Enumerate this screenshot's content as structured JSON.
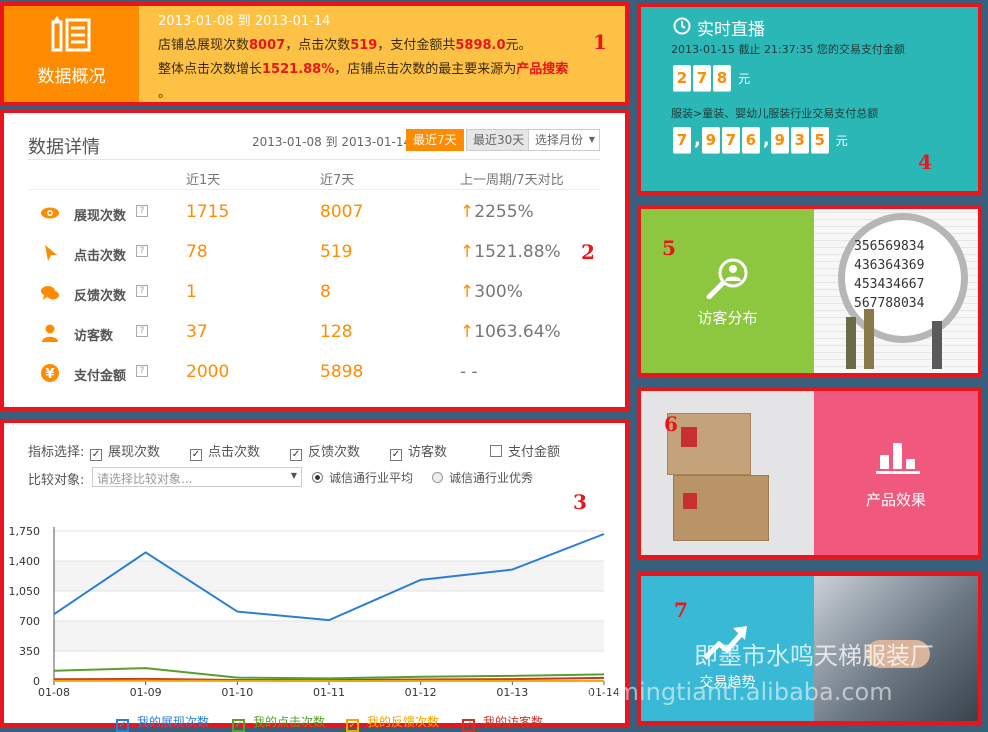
{
  "overview": {
    "title": "数据概况",
    "date_range": "2013-01-08 到 2013-01-14",
    "line1_prefix": "店铺总展现次数",
    "line1_impr": "8007",
    "line1_mid1": "，点击次数",
    "line1_click": "519",
    "line1_mid2": "，支付金额共",
    "line1_pay": "5898.0",
    "line1_suffix": "元。",
    "line2_prefix": "整体点击次数增长",
    "line2_growth": "1521.88%",
    "line2_mid": "，店铺点击次数的最主要来源为",
    "line2_source": "产品搜索",
    "line3": "。"
  },
  "detail": {
    "title": "数据详情",
    "date_range": "2013-01-08 到 2013-01-14",
    "tab_7": "最近7天",
    "tab_30": "最近30天",
    "month_select": "选择月份",
    "headers": [
      "近1天",
      "近7天",
      "上一周期/7天对比"
    ],
    "rows": [
      {
        "label": "展现次数",
        "icon": "eye-icon",
        "d1": "1715",
        "d7": "8007",
        "cmp": "2255%",
        "up": true
      },
      {
        "label": "点击次数",
        "icon": "cursor-icon",
        "d1": "78",
        "d7": "519",
        "cmp": "1521.88%",
        "up": true
      },
      {
        "label": "反馈次数",
        "icon": "chat-icon",
        "d1": "1",
        "d7": "8",
        "cmp": "300%",
        "up": true
      },
      {
        "label": "访客数",
        "icon": "user-icon",
        "d1": "37",
        "d7": "128",
        "cmp": "1063.64%",
        "up": true
      },
      {
        "label": "支付金额",
        "icon": "yen-icon",
        "d1": "2000",
        "d7": "5898",
        "cmp": "- -",
        "up": false
      }
    ],
    "help": "?"
  },
  "filters": {
    "metric_label": "指标选择:",
    "metrics": [
      {
        "label": "展现次数",
        "checked": true
      },
      {
        "label": "点击次数",
        "checked": true
      },
      {
        "label": "反馈次数",
        "checked": true
      },
      {
        "label": "访客数",
        "checked": true
      },
      {
        "label": "支付金额",
        "checked": false
      }
    ],
    "compare_label": "比较对象:",
    "compare_placeholder": "请选择比较对象...",
    "radio_avg": "诚信通行业平均",
    "radio_best": "诚信通行业优秀"
  },
  "chart_data": {
    "type": "line",
    "x": [
      "01-08",
      "01-09",
      "01-10",
      "01-11",
      "01-12",
      "01-13",
      "01-14"
    ],
    "yticks": [
      "1,750",
      "1,400",
      "1,050",
      "700",
      "350",
      "0"
    ],
    "ylim": [
      0,
      1750
    ],
    "grid": true,
    "legend_position": "bottom",
    "series": [
      {
        "name": "我的展现次数",
        "color": "#2a7fd4",
        "values": [
          780,
          1500,
          810,
          710,
          1180,
          1300,
          1715
        ]
      },
      {
        "name": "我的点击次数",
        "color": "#5a9e2f",
        "values": [
          120,
          150,
          40,
          30,
          50,
          60,
          78
        ]
      },
      {
        "name": "我的反馈次数",
        "color": "#f0a500",
        "values": [
          2,
          3,
          1,
          0,
          1,
          1,
          1
        ]
      },
      {
        "name": "我的访客数",
        "color": "#c0392b",
        "values": [
          20,
          25,
          12,
          10,
          18,
          22,
          37
        ]
      }
    ]
  },
  "live": {
    "title": "实时直播",
    "date": "2013-01-15",
    "cut": "截止",
    "time": "21:37:35",
    "desc1": "您的交易支付金额",
    "amount_digits": [
      "2",
      "7",
      "8"
    ],
    "unit": "元",
    "desc2": "服装>童装、婴幼儿服装行业交易支付总额",
    "total_digits": [
      "7",
      ",",
      "9",
      "7",
      "6",
      ",",
      "9",
      "3",
      "5"
    ]
  },
  "tiles": {
    "visitors": "访客分布",
    "products": "产品效果",
    "trade": "交易趋势"
  },
  "photo_text": {
    "magnifier_numbers": [
      "356569834",
      "436364369",
      "453434667",
      "567788034"
    ]
  },
  "watermark": {
    "cn": "即墨市水鸣天梯服装厂",
    "en": "shuimingtianti.alibaba.com"
  },
  "markers": [
    "1",
    "2",
    "3",
    "4",
    "5",
    "6",
    "7"
  ],
  "colors": {
    "orange": "#ff8c00",
    "yellow": "#fdc245",
    "teal": "#2ab7b5",
    "green": "#8dc63f",
    "pink": "#f0587d",
    "blue": "#39b9d6",
    "red_frame": "#e8161c"
  }
}
